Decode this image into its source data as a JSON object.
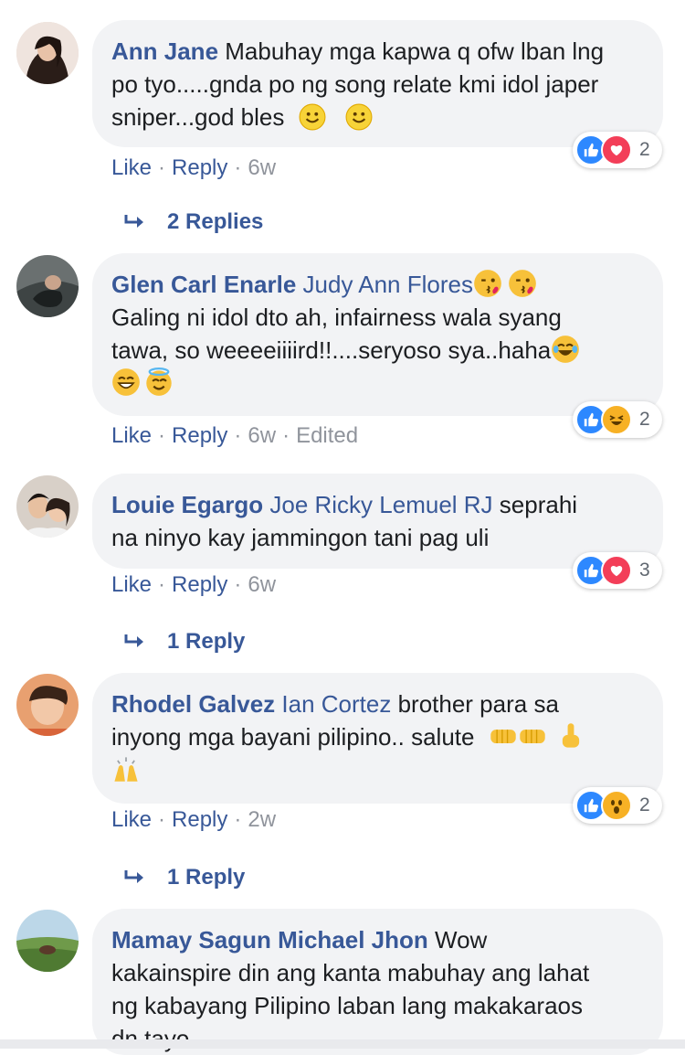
{
  "comments": [
    {
      "author": "Ann Jane",
      "mention": "",
      "text_lines": [
        "Mabuhay mga kapwa q ofw lban lng",
        "po tyo.....gnda po ng song relate kmi idol japer",
        "sniper...god bles"
      ],
      "reactions": [
        "like-icon",
        "love-icon"
      ],
      "reaction_count": "2",
      "like_label": "Like",
      "reply_label": "Reply",
      "time": "6w",
      "edited": "",
      "replies_label": "2 Replies"
    },
    {
      "author": "Glen Carl Enarle",
      "mention": "Judy Ann Flores",
      "text_lines": [
        "Galing ni idol dto ah, infairness wala syang",
        "tawa, so weeeeiiiird!!....seryoso sya..haha"
      ],
      "reactions": [
        "like-icon",
        "haha-icon"
      ],
      "reaction_count": "2",
      "like_label": "Like",
      "reply_label": "Reply",
      "time": "6w",
      "edited": "Edited",
      "replies_label": ""
    },
    {
      "author": "Louie Egargo",
      "mention": "Joe Ricky Lemuel RJ",
      "text_lines": [
        "seprahi",
        "na ninyo kay jammingon tani pag uli"
      ],
      "reactions": [
        "like-icon",
        "love-icon"
      ],
      "reaction_count": "3",
      "like_label": "Like",
      "reply_label": "Reply",
      "time": "6w",
      "edited": "",
      "replies_label": "1 Reply"
    },
    {
      "author": "Rhodel Galvez",
      "mention": "Ian Cortez",
      "text_lines": [
        "brother para sa",
        "inyong mga bayani pilipino.. salute"
      ],
      "reactions": [
        "like-icon",
        "wow-icon"
      ],
      "reaction_count": "2",
      "like_label": "Like",
      "reply_label": "Reply",
      "time": "2w",
      "edited": "",
      "replies_label": "1 Reply"
    },
    {
      "author": "Mamay Sagun",
      "mention": "Michael Jhon",
      "text_lines": [
        "Wow",
        "kakainspire din ang kanta mabuhay ang lahat",
        "ng kabayang Pilipino laban lang makakaraos",
        "dn tayo."
      ]
    }
  ],
  "colors": {
    "link": "#385898",
    "meta": "#90949c",
    "bubble": "#f2f3f5",
    "like": "#2d88ff",
    "love": "#f33e58",
    "haha": "#f7b125"
  }
}
